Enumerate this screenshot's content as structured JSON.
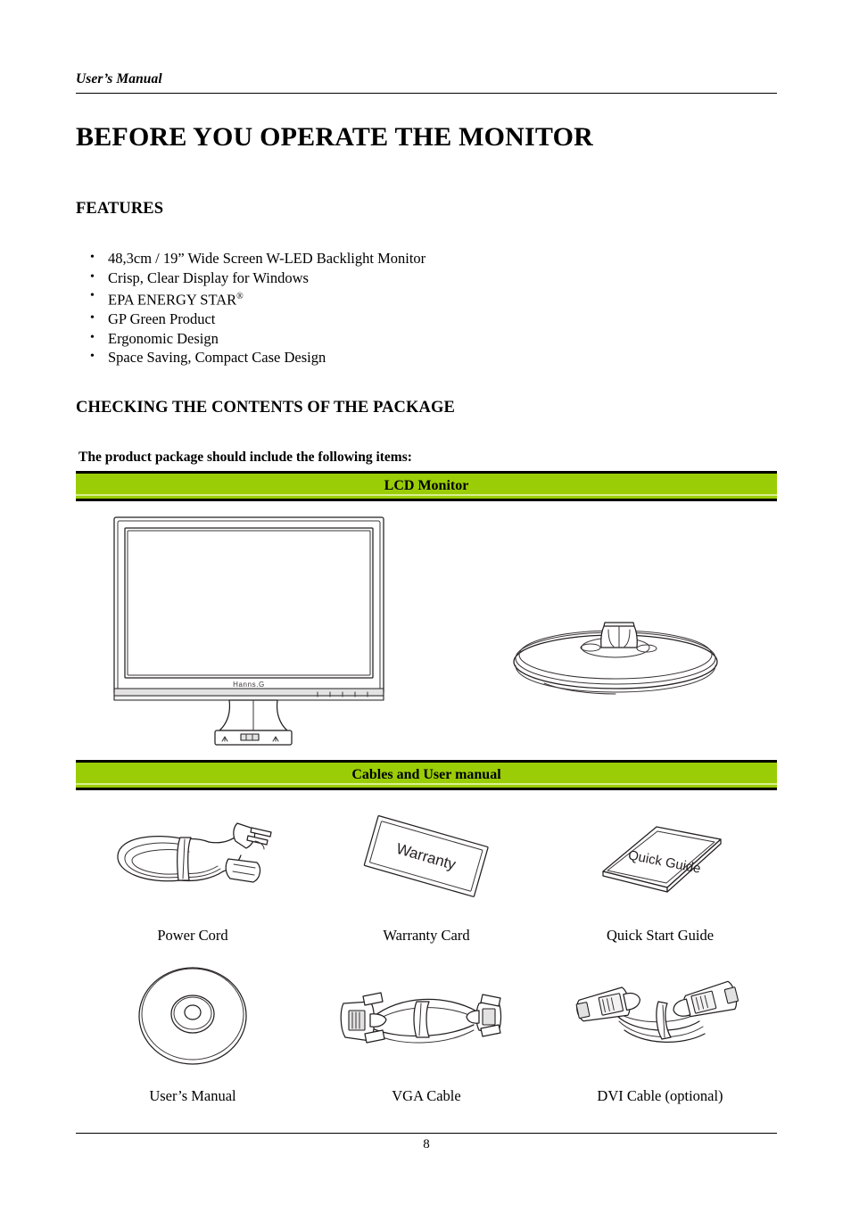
{
  "header": {
    "running_head": "User’s Manual"
  },
  "document": {
    "title": "BEFORE YOU OPERATE THE MONITOR"
  },
  "features": {
    "heading": "FEATURES",
    "items": [
      "48,3cm / 19”  Wide Screen W-LED Backlight Monitor",
      "Crisp, Clear Display for Windows",
      "EPA ENERGY STAR",
      "GP Green Product",
      "Ergonomic Design",
      "Space Saving, Compact Case Design"
    ],
    "energy_star_superscript": "®"
  },
  "package": {
    "heading": "CHECKING THE CONTENTS OF THE PACKAGE",
    "intro": "The product package should include the following items:",
    "band_lcd_label": "LCD Monitor",
    "band_cables_label": "Cables and User manual",
    "band_color": "#9ACD05",
    "monitor_brand_logo": "Hanns.G",
    "accessories": [
      {
        "label": "Power Cord",
        "icon": "power-cord-icon"
      },
      {
        "label": "Warranty Card",
        "icon": "warranty-card-icon",
        "card_text": "Warranty"
      },
      {
        "label": "Quick Start Guide",
        "icon": "quick-guide-icon",
        "card_text": "Quick Guide"
      },
      {
        "label": "User’s Manual",
        "icon": "cd-disc-icon"
      },
      {
        "label": "VGA Cable",
        "icon": "vga-cable-icon"
      },
      {
        "label": "DVI Cable (optional)",
        "icon": "dvi-cable-icon"
      }
    ]
  },
  "footer": {
    "page_number": "8"
  }
}
